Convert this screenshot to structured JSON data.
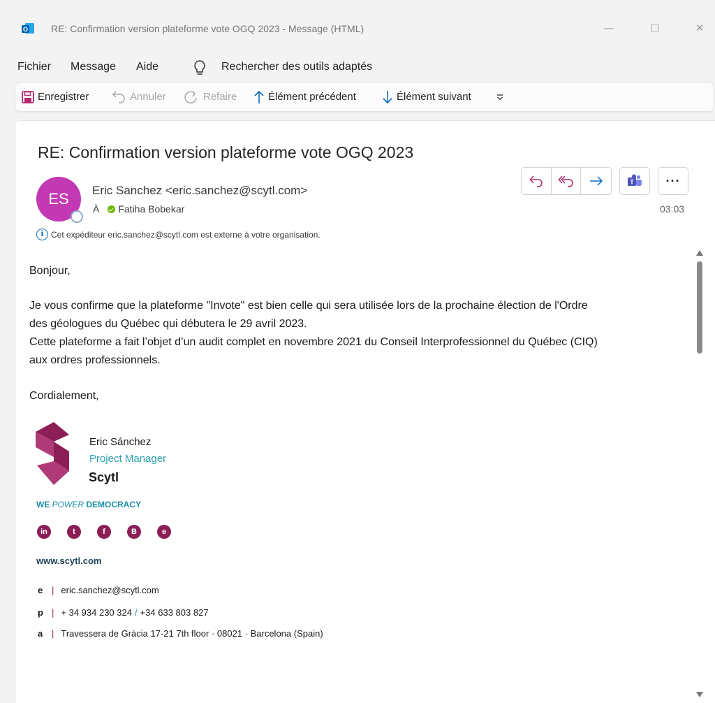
{
  "window": {
    "title": "RE: Confirmation version plateforme vote OGQ 2023  -  Message (HTML)",
    "minimize_glyph": "—",
    "maximize_glyph": "☐",
    "close_glyph": "✕",
    "app_icon": "outlook-icon"
  },
  "menu": {
    "items": [
      "Fichier",
      "Message",
      "Aide"
    ],
    "search_label": "Rechercher des outils adaptés"
  },
  "ribbon": {
    "save": "Enregistrer",
    "undo": "Annuler",
    "redo": "Refaire",
    "previous": "Élément précédent",
    "next": "Élément suivant"
  },
  "message": {
    "subject": "RE: Confirmation version plateforme vote OGQ 2023",
    "avatar_initials": "ES",
    "avatar_color": "#c239b3",
    "sender": "Eric Sanchez <eric.sanchez@scytl.com>",
    "to_label": "À",
    "recipient": "Fatiha Bobekar",
    "time": "03:03",
    "external_notice": "Cet expéditeur eric.sanchez@scytl.com est externe à votre organisation.",
    "more_glyph": "···",
    "teams_glyph": "T"
  },
  "body": {
    "greeting": "Bonjour,",
    "line1": "Je vous confirme que la plateforme \"Invote\" est bien celle qui sera utilisée lors de la prochaine élection de l'Ordre",
    "line2": "des géologues du Québec qui débutera le 29 avril 2023.",
    "line3": "Cette plateforme a fait l’objet d’un audit complet en novembre 2021 du Conseil Interprofessionnel du Québec (CIQ)",
    "line4": "aux ordres professionnels.",
    "closing": "Cordialement,"
  },
  "signature": {
    "name": "Eric Sánchez",
    "role": "Project Manager",
    "company": "Scytl",
    "tagline_we": "WE ",
    "tagline_power": "POWER",
    "tagline_democracy": " DEMOCRACY",
    "social": [
      {
        "name": "linkedin-icon",
        "glyph": "in"
      },
      {
        "name": "twitter-icon",
        "glyph": "t"
      },
      {
        "name": "facebook-icon",
        "glyph": "f"
      },
      {
        "name": "blog-icon",
        "glyph": "B"
      },
      {
        "name": "website-icon",
        "glyph": "e"
      }
    ],
    "website": "www.scytl.com",
    "email_key": "e",
    "email": "eric.sanchez@scytl.com",
    "phone_key": "p",
    "phone1": "+ 34 934 230 324",
    "phone2": "+34 633 803 827",
    "address_key": "a",
    "address": "Travessera de Gràcia 17-21 7th floor · 08021 · Barcelona (Spain)",
    "separator": "|",
    "phone_separator": "/",
    "brand_color": "#8c1e56",
    "accent_color": "#2a9fb0"
  }
}
